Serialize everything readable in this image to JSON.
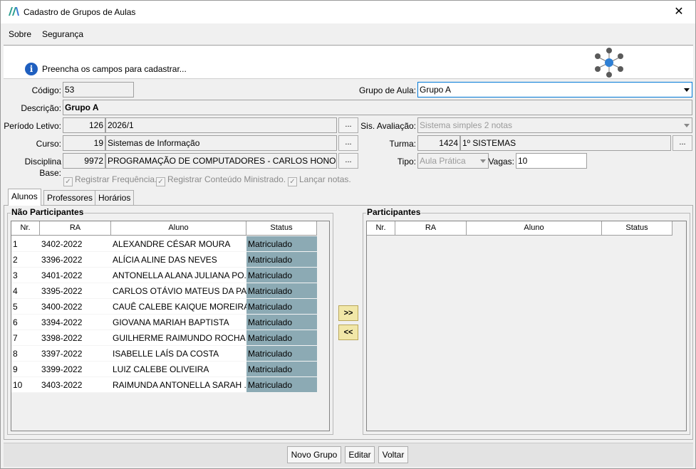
{
  "window": {
    "title": "Cadastro de Grupos de Aulas",
    "close_glyph": "✕"
  },
  "menu": [
    "Sobre",
    "Segurança"
  ],
  "header": {
    "info_text": "Preencha os campos para cadastrar..."
  },
  "form": {
    "codigo_label": "Código:",
    "codigo_value": "53",
    "grupo_aula_label": "Grupo de Aula:",
    "grupo_aula_value": "Grupo A",
    "descricao_label": "Descrição:",
    "descricao_value": "Grupo A",
    "periodo_label": "Período Letivo:",
    "periodo_code": "126",
    "periodo_name": "2026/1",
    "sis_avaliacao_label": "Sis. Avaliação:",
    "sis_avaliacao_value": "Sistema simples 2 notas",
    "curso_label": "Curso:",
    "curso_code": "19",
    "curso_name": "Sistemas de Informação",
    "turma_label": "Turma:",
    "turma_code": "1424",
    "turma_name": "1º SISTEMAS",
    "disciplina_label": "Disciplina Base:",
    "disciplina_code": "9972",
    "disciplina_name": "PROGRAMAÇÃO DE COMPUTADORES - CARLOS HONORINA",
    "tipo_label": "Tipo:",
    "tipo_value": "Aula Prática",
    "vagas_label": "Vagas:",
    "vagas_value": "10",
    "dots": "...",
    "checkboxes": [
      "Registrar Frequência.",
      "Registrar Conteúdo Ministrado.",
      "Lançar notas."
    ],
    "check_glyph": "✓"
  },
  "tabs": [
    "Alunos",
    "Professores",
    "Horários"
  ],
  "grid_columns": [
    "Nr.",
    "RA",
    "Aluno",
    "Status"
  ],
  "nao_participantes": {
    "title": "Não Participantes",
    "rows": [
      [
        "1",
        "3402-2022",
        "ALEXANDRE CÉSAR MOURA",
        "Matriculado"
      ],
      [
        "2",
        "3396-2022",
        "ALÍCIA ALINE DAS NEVES",
        "Matriculado"
      ],
      [
        "3",
        "3401-2022",
        "ANTONELLA ALANA JULIANA PO...",
        "Matriculado"
      ],
      [
        "4",
        "3395-2022",
        "CARLOS OTÁVIO MATEUS DA PAZ",
        "Matriculado"
      ],
      [
        "5",
        "3400-2022",
        "CAUÊ CALEBE KAIQUE MOREIRA",
        "Matriculado"
      ],
      [
        "6",
        "3394-2022",
        "GIOVANA MARIAH BAPTISTA",
        "Matriculado"
      ],
      [
        "7",
        "3398-2022",
        "GUILHERME RAIMUNDO ROCHA",
        "Matriculado"
      ],
      [
        "8",
        "3397-2022",
        "ISABELLE LAÍS DA COSTA",
        "Matriculado"
      ],
      [
        "9",
        "3399-2022",
        "LUIZ CALEBE OLIVEIRA",
        "Matriculado"
      ],
      [
        "10",
        "3403-2022",
        "RAIMUNDA ANTONELLA SARAH ...",
        "Matriculado"
      ]
    ]
  },
  "participantes": {
    "title": "Participantes",
    "rows": []
  },
  "move": {
    "add": ">>",
    "remove": "<<"
  },
  "buttons": {
    "novo": "Novo Grupo",
    "editar": "Editar",
    "voltar": "Voltar"
  }
}
